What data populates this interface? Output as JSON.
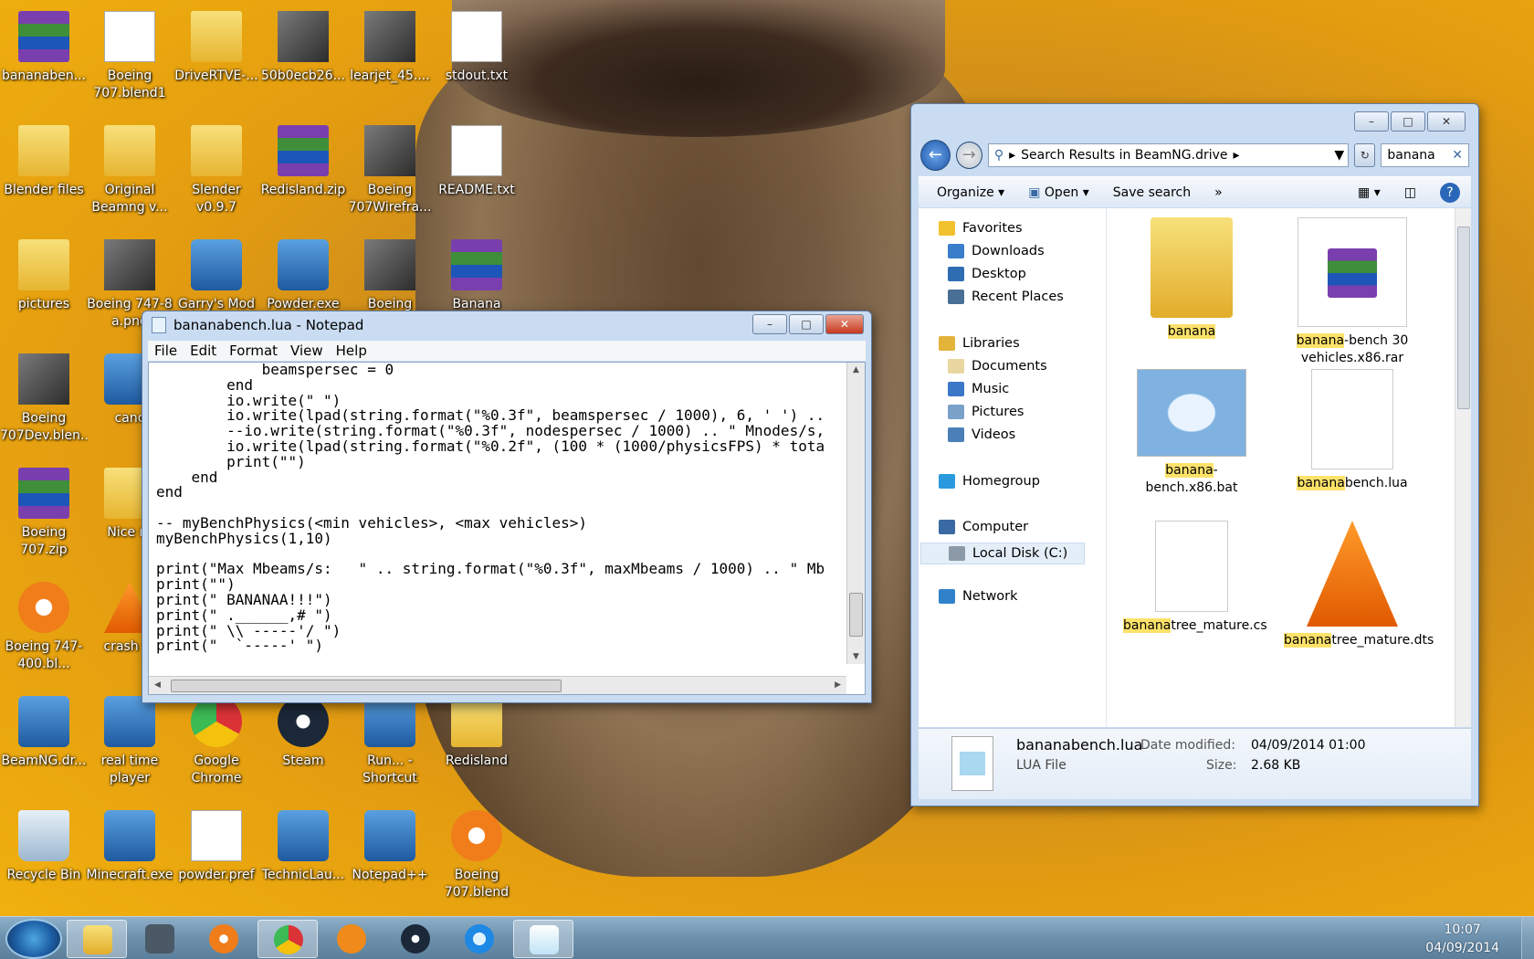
{
  "desktop": {
    "icons": [
      {
        "label": "bananaben...",
        "type": "rar"
      },
      {
        "label": "Boeing 707.blend1",
        "type": "file"
      },
      {
        "label": "DriveRTVE-...",
        "type": "folder"
      },
      {
        "label": "50b0ecb26...",
        "type": "image"
      },
      {
        "label": "learjet_45....",
        "type": "image"
      },
      {
        "label": "stdout.txt",
        "type": "file"
      },
      {
        "label": "Blender files",
        "type": "folder"
      },
      {
        "label": "Original Beamng v...",
        "type": "folder"
      },
      {
        "label": "Slender v0.9.7",
        "type": "folder"
      },
      {
        "label": "Redisland.zip",
        "type": "rar"
      },
      {
        "label": "Boeing 707Wirefra...",
        "type": "image"
      },
      {
        "label": "README.txt",
        "type": "file"
      },
      {
        "label": "pictures",
        "type": "folder"
      },
      {
        "label": "Boeing 747-8 a.png",
        "type": "image"
      },
      {
        "label": "Garry's Mod",
        "type": "app"
      },
      {
        "label": "Powder.exe",
        "type": "app"
      },
      {
        "label": "Boeing",
        "type": "image"
      },
      {
        "label": "Banana",
        "type": "rar"
      },
      {
        "label": "Boeing 707Dev.blen...",
        "type": "image"
      },
      {
        "label": "canc",
        "type": "app"
      },
      {
        "label": "Boeing 707.zip",
        "type": "rar"
      },
      {
        "label": "Nice ro",
        "type": "folder"
      },
      {
        "label": "Boeing 747-400.bl...",
        "type": "blender"
      },
      {
        "label": "crash (2",
        "type": "vlc"
      },
      {
        "label": "BeamNG.dr...",
        "type": "app"
      },
      {
        "label": "real time player",
        "type": "app"
      },
      {
        "label": "Google Chrome",
        "type": "chrome"
      },
      {
        "label": "Steam",
        "type": "steam"
      },
      {
        "label": "Run... - Shortcut",
        "type": "app"
      },
      {
        "label": "Redisland",
        "type": "folder"
      },
      {
        "label": "Recycle Bin",
        "type": "bin"
      },
      {
        "label": "Minecraft.exe",
        "type": "app"
      },
      {
        "label": "powder.pref",
        "type": "file"
      },
      {
        "label": "TechnicLau...",
        "type": "app"
      },
      {
        "label": "Notepad++",
        "type": "app"
      },
      {
        "label": "Boeing 707.blend",
        "type": "blender"
      }
    ]
  },
  "notepad": {
    "title": "bananabench.lua - Notepad",
    "menu": [
      "File",
      "Edit",
      "Format",
      "View",
      "Help"
    ],
    "code": [
      "            beamspersec = 0",
      "        end",
      "        io.write(\" \")",
      "        io.write(lpad(string.format(\"%0.3f\", beamspersec / 1000), 6, ' ') ..",
      "        --io.write(string.format(\"%0.3f\", nodespersec / 1000) .. \" Mnodes/s,",
      "        io.write(lpad(string.format(\"%0.2f\", (100 * (1000/physicsFPS) * tota",
      "        print(\"\")",
      "    end",
      "end",
      "",
      "-- myBenchPhysics(<min vehicles>, <max vehicles>)",
      "myBenchPhysics(1,10)",
      "",
      "print(\"Max Mbeams/s:   \" .. string.format(\"%0.3f\", maxMbeams / 1000) .. \" Mb",
      "print(\"\")",
      "print(\" BANANAA!!!\")",
      "print(\" .______,# \")",
      "print(\" \\\\ -----'/ \")",
      "print(\"  `-----' \")"
    ]
  },
  "explorer": {
    "address": "Search Results in BeamNG.drive",
    "search_value": "banana",
    "toolbar": [
      "Organize",
      "Open",
      "Save search"
    ],
    "nav": [
      {
        "label": "Favorites",
        "level": 0
      },
      {
        "label": "Downloads",
        "level": 1
      },
      {
        "label": "Desktop",
        "level": 1
      },
      {
        "label": "Recent Places",
        "level": 1
      },
      {
        "label": "Libraries",
        "level": 0
      },
      {
        "label": "Documents",
        "level": 1
      },
      {
        "label": "Music",
        "level": 1
      },
      {
        "label": "Pictures",
        "level": 1
      },
      {
        "label": "Videos",
        "level": 1
      },
      {
        "label": "Homegroup",
        "level": 0
      },
      {
        "label": "Computer",
        "level": 0
      },
      {
        "label": "Local Disk (C:)",
        "level": 1
      },
      {
        "label": "Network",
        "level": 0
      }
    ],
    "files": [
      {
        "hl": "banana",
        "rest": "",
        "type": "folder"
      },
      {
        "hl": "banana",
        "rest": "-bench 30 vehicles.x86.rar",
        "type": "rar"
      },
      {
        "hl": "banana",
        "rest": "-bench.x86.bat",
        "type": "bat"
      },
      {
        "hl": "banana",
        "rest": "bench.lua",
        "type": "lua"
      },
      {
        "hl": "banana",
        "rest": "tree_mature.cs",
        "type": "cs"
      },
      {
        "hl": "banana",
        "rest": "tree_mature.dts",
        "type": "vlc"
      }
    ],
    "details": {
      "name": "bananabench.lua",
      "type": "LUA File",
      "date_label": "Date modified:",
      "date_value": "04/09/2014 01:00",
      "size_label": "Size:",
      "size_value": "2.68 KB"
    }
  },
  "taskbar": {
    "time": "10:07",
    "date": "04/09/2014"
  }
}
